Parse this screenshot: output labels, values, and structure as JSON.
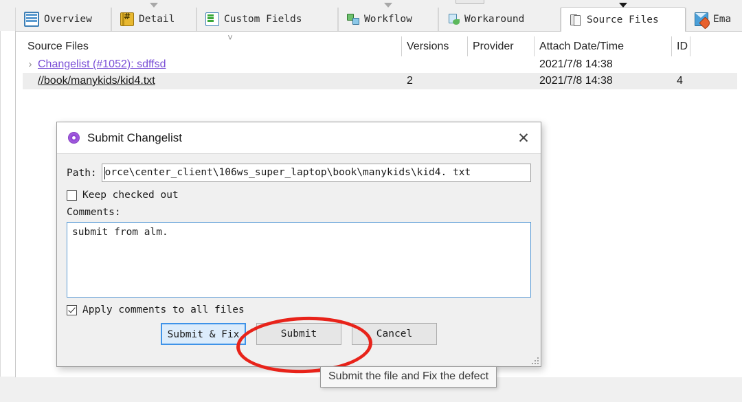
{
  "tabs": [
    {
      "label": "Overview",
      "icon": "overview-icon",
      "selected": false,
      "caret": false
    },
    {
      "label": "Detail",
      "icon": "detail-icon",
      "selected": false,
      "caret": true
    },
    {
      "label": "Custom Fields",
      "icon": "custom-fields-icon",
      "selected": false,
      "caret": false
    },
    {
      "label": "Workflow",
      "icon": "workflow-icon",
      "selected": false,
      "caret": true
    },
    {
      "label": "Workaround",
      "icon": "workaround-icon",
      "selected": false,
      "caret": false
    },
    {
      "label": "Source Files",
      "icon": "source-files-icon",
      "selected": true,
      "caret": true
    },
    {
      "label": "Ema",
      "icon": "email-icon",
      "selected": false,
      "caret": false
    }
  ],
  "table": {
    "columns": [
      "Source Files",
      "Versions",
      "Provider",
      "Attach Date/Time",
      "ID"
    ],
    "rows": [
      {
        "expander": "›",
        "name": "Changelist (#1052): sdffsd ",
        "name_style": "changelist-link",
        "versions": "",
        "provider": "",
        "attach_date": "2021/7/8 14:38",
        "id": ""
      },
      {
        "expander": "",
        "name": "//book/manykids/kid4.txt",
        "name_style": "file-link",
        "versions": "2",
        "provider": "",
        "attach_date": "2021/7/8 14:38",
        "id": "4"
      }
    ]
  },
  "dialog": {
    "title": "Submit Changelist",
    "icon": "submit-changelist-icon",
    "close_label": "✕",
    "path_label": "Path:",
    "path_value": "orce\\center_client\\106ws_super_laptop\\book\\manykids\\kid4. txt",
    "keep_checked_out_label": "Keep checked out",
    "keep_checked_out_checked": false,
    "comments_label": "Comments:",
    "comments_value": "submit from alm.",
    "apply_all_label": "Apply comments to all files",
    "apply_all_checked": true,
    "buttons": [
      {
        "label": "Submit & Fix",
        "focused": true
      },
      {
        "label": "Submit",
        "focused": false
      },
      {
        "label": "Cancel",
        "focused": false
      }
    ]
  },
  "tooltip": {
    "text": "Submit the file and Fix the defect"
  },
  "annotation": {
    "shape": "ellipse",
    "color": "#e8231a",
    "target": "Submit & Fix"
  }
}
